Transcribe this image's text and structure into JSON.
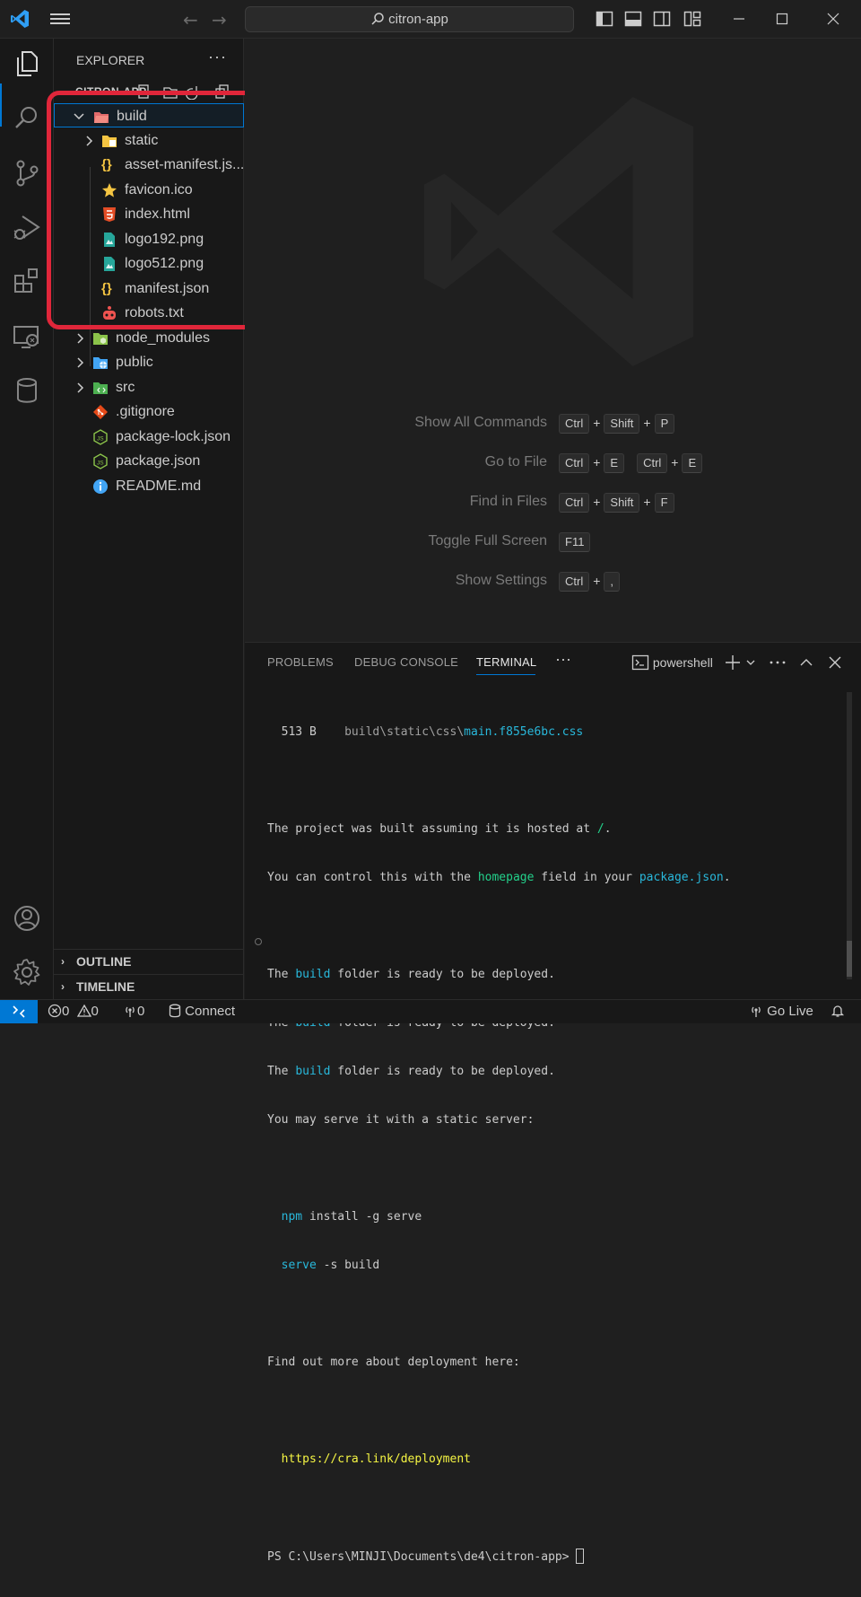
{
  "titlebar": {
    "search_text": "citron-app",
    "back_icon": "arrow-left-icon",
    "forward_icon": "arrow-right-icon"
  },
  "sidebar": {
    "title": "EXPLORER",
    "more_label": "···",
    "project_name": "CITRON-APP",
    "tree": [
      {
        "label": "build",
        "type": "folder-open",
        "level": 1,
        "selected": true
      },
      {
        "label": "static",
        "type": "folder",
        "level": 2
      },
      {
        "label": "asset-manifest.js...",
        "type": "json",
        "level": 2
      },
      {
        "label": "favicon.ico",
        "type": "favicon",
        "level": 2
      },
      {
        "label": "index.html",
        "type": "html",
        "level": 2
      },
      {
        "label": "logo192.png",
        "type": "image",
        "level": 2
      },
      {
        "label": "logo512.png",
        "type": "image",
        "level": 2
      },
      {
        "label": "manifest.json",
        "type": "json",
        "level": 2
      },
      {
        "label": "robots.txt",
        "type": "robots",
        "level": 2
      },
      {
        "label": "node_modules",
        "type": "folder-node",
        "level": 1
      },
      {
        "label": "public",
        "type": "folder-public",
        "level": 1
      },
      {
        "label": "src",
        "type": "folder-src",
        "level": 1
      },
      {
        "label": ".gitignore",
        "type": "git",
        "level": 1
      },
      {
        "label": "package-lock.json",
        "type": "node",
        "level": 1
      },
      {
        "label": "package.json",
        "type": "node",
        "level": 1
      },
      {
        "label": "README.md",
        "type": "info",
        "level": 1
      }
    ],
    "outline_label": "OUTLINE",
    "timeline_label": "TIMELINE"
  },
  "editor": {
    "shortcuts": [
      {
        "label": "Show All Commands",
        "keys": [
          [
            "Ctrl",
            "Shift",
            "P"
          ]
        ]
      },
      {
        "label": "Go to File",
        "keys": [
          [
            "Ctrl",
            "E"
          ],
          [
            "Ctrl",
            "E"
          ]
        ]
      },
      {
        "label": "Find in Files",
        "keys": [
          [
            "Ctrl",
            "Shift",
            "F"
          ]
        ]
      },
      {
        "label": "Toggle Full Screen",
        "keys": [
          [
            "F11"
          ]
        ]
      },
      {
        "label": "Show Settings",
        "keys": [
          [
            "Ctrl",
            ","
          ]
        ]
      }
    ]
  },
  "panel": {
    "tabs": [
      "PROBLEMS",
      "DEBUG CONSOLE",
      "TERMINAL"
    ],
    "active_tab": "TERMINAL",
    "more_label": "···",
    "shell_label": "powershell",
    "terminal": {
      "size_line": {
        "size": "  513 B",
        "dir": "build\\static\\css\\",
        "file": "main.f855e6bc.css"
      },
      "hosted_line": {
        "a": "The project was built assuming it is hosted at ",
        "b": "/",
        "c": "."
      },
      "control_line": {
        "a": "You can control this with the ",
        "b": "homepage",
        "c": " field in your ",
        "d": "package.json",
        "e": "."
      },
      "ready_lines": [
        {
          "a": "The ",
          "b": "build",
          "c": " folder is ready to be deployed."
        },
        {
          "a": "The ",
          "b": "build",
          "c": " folder is ready to be deployed."
        },
        {
          "a": "The ",
          "b": "build",
          "c": " folder is ready to be deployed."
        }
      ],
      "serve_line": "You may serve it with a static server:",
      "cmd1": {
        "a": "npm",
        "b": " install -g serve"
      },
      "cmd2": {
        "a": "serve",
        "b": " -s build"
      },
      "more_line": "Find out more about deployment here:",
      "link": "https://cra.link/deployment",
      "prompt": "PS C:\\Users\\MINJI\\Documents\\de4\\citron-app> "
    }
  },
  "statusbar": {
    "errors": "0",
    "warnings": "0",
    "ports": "0",
    "connect_label": "Connect",
    "golive_label": "Go Live"
  },
  "colors": {
    "accent": "#0078d4",
    "highlight_box": "#e0263a"
  }
}
